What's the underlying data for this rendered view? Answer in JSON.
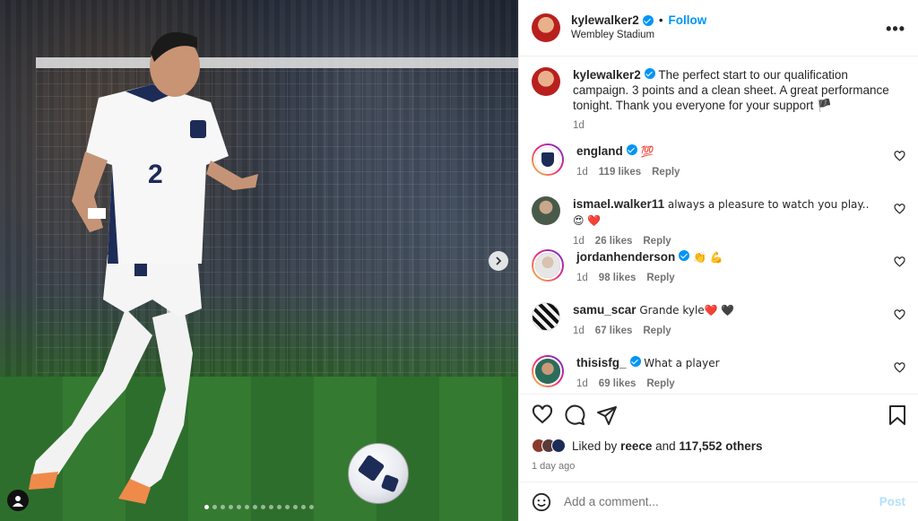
{
  "media": {
    "jersey_number": "2",
    "total_slides": 14,
    "active_slide": 1
  },
  "header": {
    "username": "kylewalker2",
    "bullet": "•",
    "follow_label": "Follow",
    "location": "Wembley Stadium",
    "more_label": "•••"
  },
  "caption": {
    "username": "kylewalker2",
    "text": "The perfect start to our qualification campaign. 3 points and a clean sheet. A great performance tonight. Thank you everyone for your support 🏴",
    "time": "1d"
  },
  "comments": [
    {
      "username": "england",
      "verified": true,
      "text": "💯",
      "time": "1d",
      "likes": "119 likes",
      "reply": "Reply"
    },
    {
      "username": "ismael.walker11",
      "verified": false,
      "text": "always a pleasure to watch you play.. 😍 ❤️",
      "time": "1d",
      "likes": "26 likes",
      "reply": "Reply"
    },
    {
      "username": "jordanhenderson",
      "verified": true,
      "text": "👏 💪",
      "time": "1d",
      "likes": "98 likes",
      "reply": "Reply"
    },
    {
      "username": "samu_scar",
      "verified": false,
      "text": "Grande kyle❤️ 🖤",
      "time": "1d",
      "likes": "67 likes",
      "reply": "Reply"
    },
    {
      "username": "thisisfg_",
      "verified": true,
      "text": "What a player",
      "time": "1d",
      "likes": "69 likes",
      "reply": "Reply"
    }
  ],
  "likes_line": {
    "prefix": "Liked by",
    "user": "reece",
    "and": "and",
    "others": "117,552 others"
  },
  "posted": "1 day ago",
  "add_comment": {
    "placeholder": "Add a comment...",
    "post_label": "Post"
  },
  "colors": {
    "accent": "#0095f6",
    "muted": "#737373",
    "post_disabled": "#b2dffc"
  }
}
